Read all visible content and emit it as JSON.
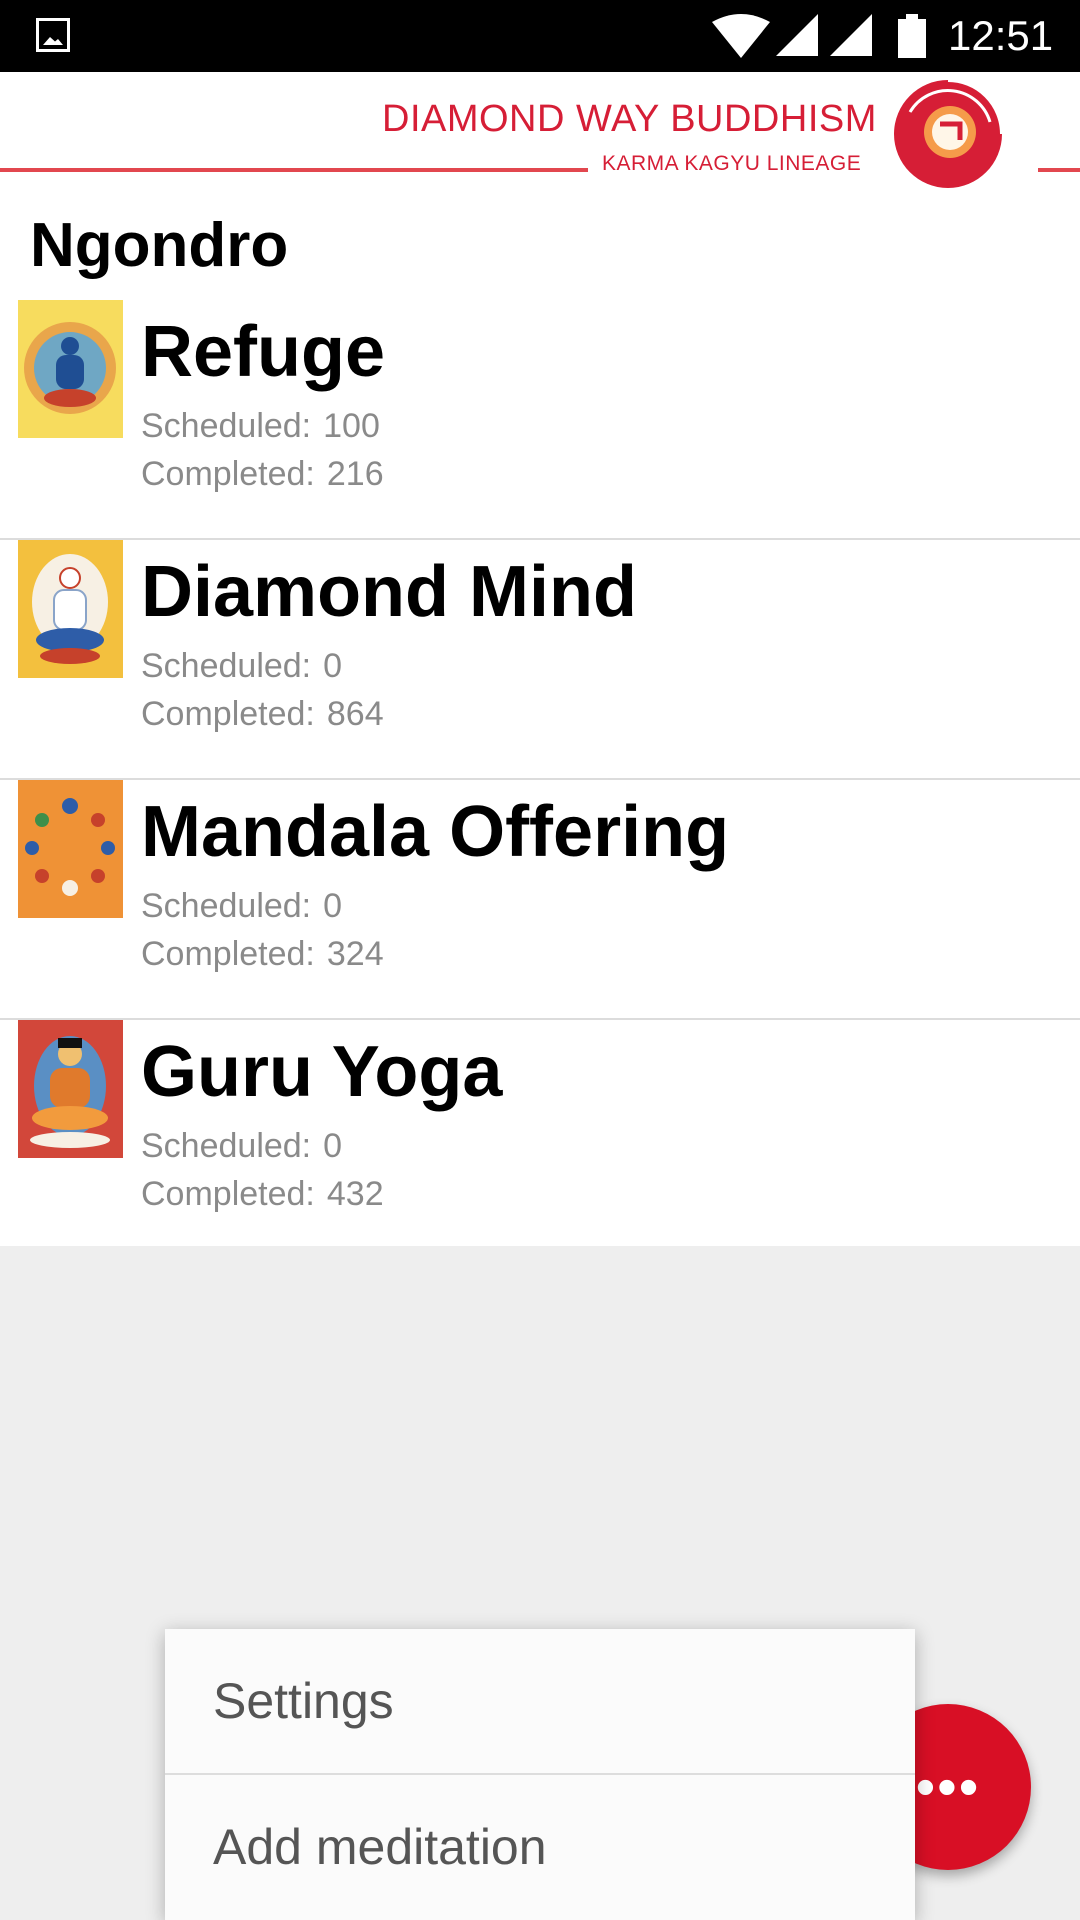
{
  "status_bar": {
    "time": "12:51",
    "icons": [
      "gallery-icon",
      "wifi-icon",
      "signal-icon",
      "signal-icon",
      "battery-icon"
    ]
  },
  "banner": {
    "title": "DIAMOND WAY BUDDHISM",
    "subtitle": "KARMA KAGYU LINEAGE",
    "brand_color": "#d61e36"
  },
  "page": {
    "title": "Ngondro"
  },
  "labels": {
    "scheduled": "Scheduled:",
    "completed": "Completed:"
  },
  "meditations": [
    {
      "name": "Refuge",
      "scheduled": "100",
      "completed": "216",
      "thumb_bg": "#f7dc5e",
      "icon": "refuge-image"
    },
    {
      "name": "Diamond Mind",
      "scheduled": "0",
      "completed": "864",
      "thumb_bg": "#f3c03e",
      "icon": "diamond-mind-image"
    },
    {
      "name": "Mandala Offering",
      "scheduled": "0",
      "completed": "324",
      "thumb_bg": "#ef9236",
      "icon": "mandala-image"
    },
    {
      "name": "Guru Yoga",
      "scheduled": "0",
      "completed": "432",
      "thumb_bg": "#d2473a",
      "icon": "guru-yoga-image"
    }
  ],
  "menu": {
    "items": [
      "Settings",
      "Add meditation"
    ]
  },
  "fab": {
    "icon": "more-dots-icon",
    "color": "#d80f25"
  }
}
